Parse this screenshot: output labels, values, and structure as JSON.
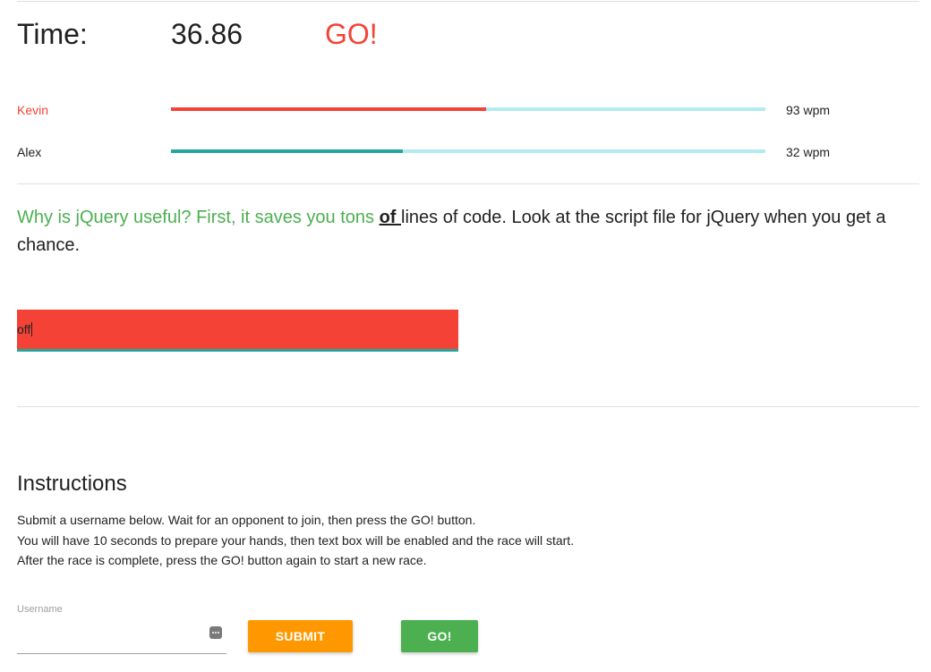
{
  "timer": {
    "label": "Time:",
    "value": "36.86",
    "status": "GO!"
  },
  "racers": [
    {
      "name": "Kevin",
      "progress": 0.53,
      "wpm_value": "93",
      "wpm_unit": "wpm",
      "color": "#f44336"
    },
    {
      "name": "Alex",
      "progress": 0.39,
      "wpm_value": "32",
      "wpm_unit": "wpm",
      "color": "#26a69a"
    }
  ],
  "track_color": "#b2ebf2",
  "passage": {
    "typed": "Why is jQuery useful? First, it saves you tons ",
    "current": "of ",
    "remaining": "lines of code. Look at the script file for jQuery when you get a chance."
  },
  "typing": {
    "value": "off",
    "error_color": "#f44336"
  },
  "instructions": {
    "title": "Instructions",
    "lines": [
      "Submit a username below. Wait for an opponent to join, then press the GO! button.",
      "You will have 10 seconds to prepare your hands, then text box will be enabled and the race will start.",
      "After the race is complete, press the GO! button again to start a new race."
    ]
  },
  "form": {
    "username_label": "Username",
    "username_value": "",
    "more_icon": "more-horiz-icon",
    "submit_label": "SUBMIT",
    "go_label": "GO!"
  }
}
